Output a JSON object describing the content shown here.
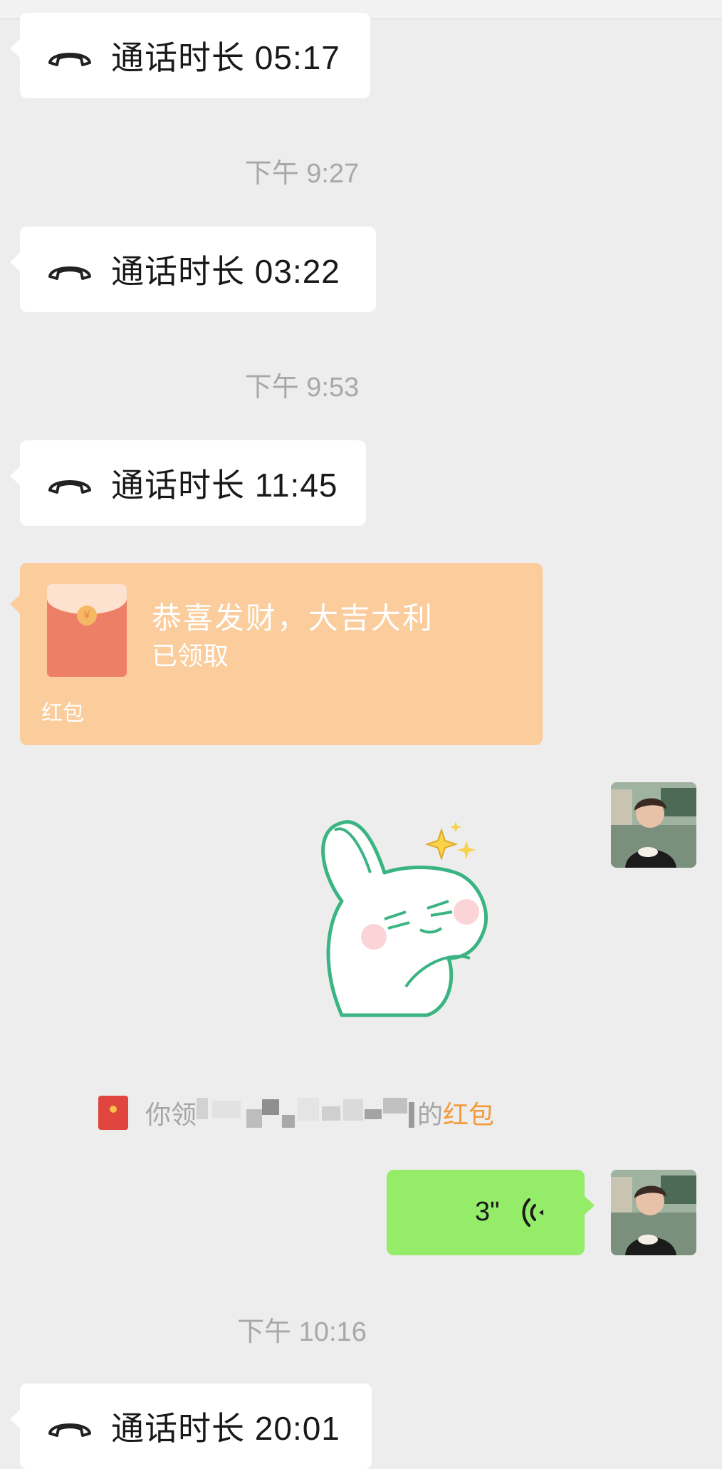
{
  "messages": {
    "call1": {
      "text": "通话时长 05:17"
    },
    "time1": "下午 9:27",
    "call2": {
      "text": "通话时长 03:22"
    },
    "time2": "下午 9:53",
    "call3": {
      "text": "通话时长 11:45"
    },
    "red_packet": {
      "title": "恭喜发财，大吉大利",
      "status": "已领取",
      "footer": "红包"
    },
    "system_notice": {
      "prefix": "你领",
      "suffix": "的",
      "link": "红包"
    },
    "voice": {
      "duration": "3\""
    },
    "time3": "下午 10:16",
    "call4": {
      "text": "通话时长 20:01"
    }
  },
  "colors": {
    "background": "#ededed",
    "bubble_incoming": "#ffffff",
    "bubble_outgoing": "#95ec69",
    "red_packet": "#fbcc9c",
    "link_orange": "#f29b3a"
  },
  "icons": {
    "call": "phone-handset-icon",
    "red_packet": "red-envelope-icon",
    "voice": "voice-wave-icon"
  }
}
